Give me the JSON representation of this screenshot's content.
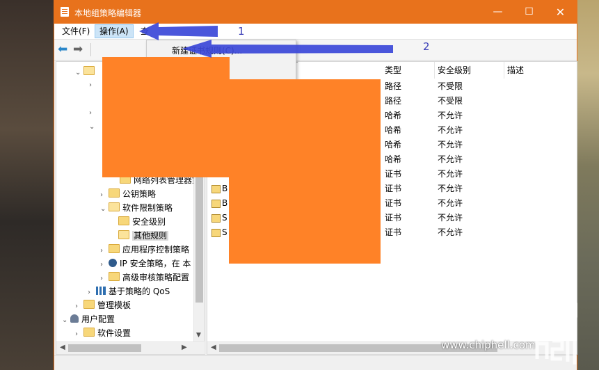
{
  "window": {
    "title": "本地组策略编辑器",
    "controls": {
      "minimize": "—",
      "maximize": "☐",
      "close": "✕"
    }
  },
  "menubar": {
    "file": "文件(F)",
    "action": "操作(A)",
    "view": "查"
  },
  "dropdown": {
    "new_cert_rule": "新建证书规则(C)..."
  },
  "tree": {
    "items": [
      {
        "label": "网络列表管理器策",
        "partial": true
      },
      {
        "label": "公钥策略"
      },
      {
        "label": "软件限制策略"
      },
      {
        "label": "安全级别"
      },
      {
        "label": "其他规则"
      },
      {
        "label": "应用程序控制策略"
      },
      {
        "label": "IP 安全策略，在 本"
      },
      {
        "label": "高级审核策略配置"
      },
      {
        "label": "基于策略的 QoS"
      },
      {
        "label": "管理模板"
      },
      {
        "label": "用户配置"
      },
      {
        "label": "软件设置"
      }
    ]
  },
  "list": {
    "columns": {
      "type": "类型",
      "security_level": "安全级别",
      "description": "描述"
    },
    "sort_caret": "^",
    "rows": [
      {
        "name": "",
        "type": "路径",
        "level": "不受限"
      },
      {
        "name": "",
        "type": "路径",
        "level": "不受限"
      },
      {
        "name": "",
        "type": "哈希",
        "level": "不允许"
      },
      {
        "name": "",
        "type": "哈希",
        "level": "不允许"
      },
      {
        "name": "",
        "type": "哈希",
        "level": "不允许"
      },
      {
        "name": "",
        "type": "哈希",
        "level": "不允许"
      },
      {
        "name": "",
        "type": "证书",
        "level": "不允许"
      },
      {
        "name": "B",
        "type": "证书",
        "level": "不允许"
      },
      {
        "name": "B",
        "type": "证书",
        "level": "不允许"
      },
      {
        "name": "S",
        "type": "证书",
        "level": "不允许"
      },
      {
        "name": "S",
        "type": "证书",
        "level": "不允许"
      }
    ]
  },
  "annotations": {
    "label_1": "1",
    "label_2": "2"
  },
  "watermark": {
    "url": "www.chiphell.com"
  },
  "colors": {
    "accent": "#e8721c",
    "redaction": "#ff8227",
    "arrow": "#3b48d8"
  }
}
